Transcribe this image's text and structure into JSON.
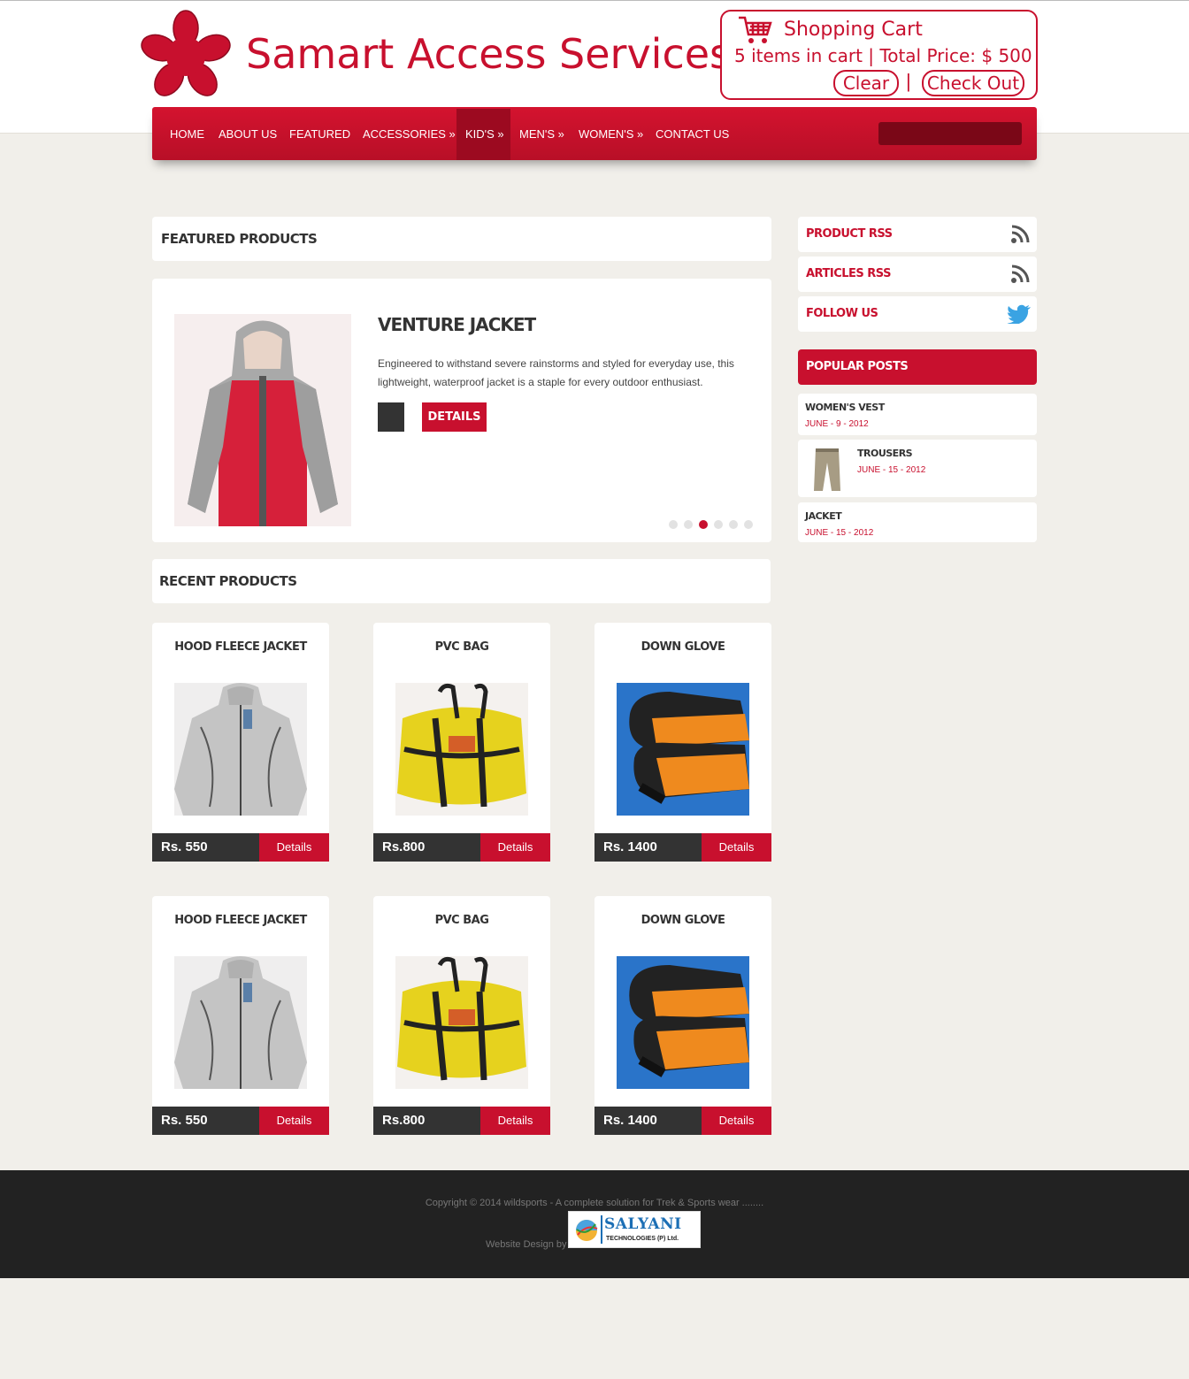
{
  "header": {
    "site_title": "Samart Access Services",
    "brand_color": "#c8102e"
  },
  "cart": {
    "title": "Shopping Cart",
    "summary": "5 items in cart | Total Price: $ 500",
    "clear_label": "Clear",
    "separator": "|",
    "checkout_label": "Check Out"
  },
  "nav": {
    "items": [
      {
        "label": "HOME"
      },
      {
        "label": "ABOUT US"
      },
      {
        "label": "FEATURED"
      },
      {
        "label": "ACCESSORIES »"
      },
      {
        "label": "KID'S »",
        "active": true
      },
      {
        "label": "MEN'S »"
      },
      {
        "label": "WOMEN'S »"
      },
      {
        "label": "CONTACT US"
      }
    ],
    "search_placeholder": ""
  },
  "featured": {
    "heading": "FEATURED PRODUCTS",
    "slide": {
      "title": "VENTURE JACKET",
      "description": "Engineered to withstand severe rainstorms and styled for everyday use, this lightweight, waterproof jacket is a staple for every outdoor enthusiast.",
      "details_label": "DETAILS"
    },
    "slide_count": 6,
    "active_slide": 3
  },
  "recent": {
    "heading": "RECENT PRODUCTS",
    "products": [
      {
        "name": "HOOD FLEECE JACKET",
        "price": "Rs. 550",
        "details_label": "Details",
        "image": "fleece-jacket"
      },
      {
        "name": "PVC BAG",
        "price": "Rs.800",
        "details_label": "Details",
        "image": "pvc-bag"
      },
      {
        "name": "DOWN GLOVE",
        "price": "Rs. 1400",
        "details_label": "Details",
        "image": "down-glove"
      },
      {
        "name": "HOOD FLEECE JACKET",
        "price": "Rs. 550",
        "details_label": "Details",
        "image": "fleece-jacket"
      },
      {
        "name": "PVC BAG",
        "price": "Rs.800",
        "details_label": "Details",
        "image": "pvc-bag"
      },
      {
        "name": "DOWN GLOVE",
        "price": "Rs. 1400",
        "details_label": "Details",
        "image": "down-glove"
      }
    ]
  },
  "sidebar": {
    "links": [
      {
        "label": "PRODUCT RSS",
        "icon": "rss-icon"
      },
      {
        "label": "ARTICLES RSS",
        "icon": "rss-icon"
      },
      {
        "label": "FOLLOW US",
        "icon": "twitter-icon"
      }
    ],
    "popular_heading": "POPULAR POSTS",
    "posts": [
      {
        "title": "WOMEN'S VEST",
        "date": "JUNE - 9 - 2012"
      },
      {
        "title": "TROUSERS",
        "date": "JUNE - 15 - 2012",
        "image": "trousers"
      },
      {
        "title": "JACKET",
        "date": "JUNE - 15 - 2012"
      }
    ]
  },
  "footer": {
    "copyright": "Copyright © 2014 wildsports - A complete solution for Trek & Sports wear ........",
    "design_by": "Website Design by",
    "designer_name": "SALYANI",
    "designer_sub": "TECHNOLOGIES (P) Ltd."
  }
}
